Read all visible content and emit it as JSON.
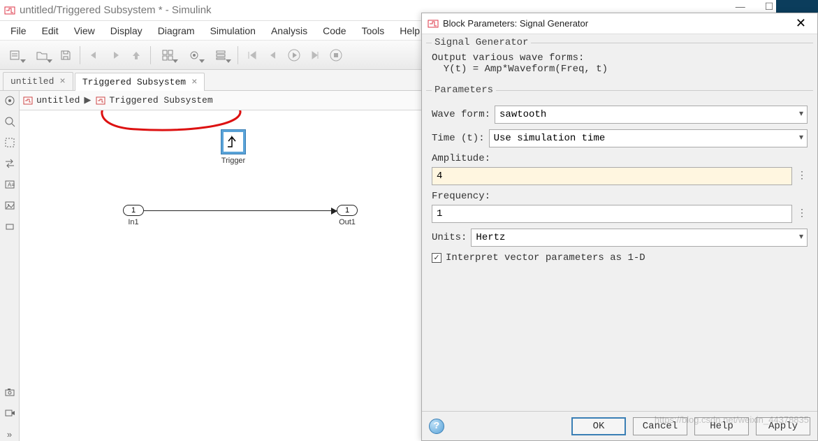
{
  "titlebar": {
    "text": "untitled/Triggered Subsystem * - Simulink"
  },
  "menu": [
    "File",
    "Edit",
    "View",
    "Display",
    "Diagram",
    "Simulation",
    "Analysis",
    "Code",
    "Tools",
    "Help"
  ],
  "tabs": {
    "items": [
      {
        "label": "untitled",
        "active": false
      },
      {
        "label": "Triggered Subsystem",
        "active": true
      }
    ]
  },
  "breadcrumb": {
    "a": "untitled",
    "b": "Triggered Subsystem"
  },
  "blocks": {
    "trigger_label": "Trigger",
    "in_port_num": "1",
    "in_label": "In1",
    "out_port_num": "1",
    "out_label": "Out1"
  },
  "dialog": {
    "title": "Block Parameters: Signal Generator",
    "section_title": "Signal Generator",
    "desc_line1": "Output various wave forms:",
    "desc_line2": "  Y(t) = Amp*Waveform(Freq, t)",
    "params_legend": "Parameters",
    "waveform_label": "Wave form:",
    "waveform_value": "sawtooth",
    "time_label": "Time (t):",
    "time_value": "Use simulation time",
    "amplitude_label": "Amplitude:",
    "amplitude_value": "4",
    "frequency_label": "Frequency:",
    "frequency_value": "1",
    "units_label": "Units:",
    "units_value": "Hertz",
    "checkbox_label": "Interpret vector parameters as 1-D",
    "ok": "OK",
    "cancel": "Cancel",
    "help": "Help",
    "apply": "Apply"
  },
  "watermark": "https://blog.csdn.net/weixin_44378835",
  "bg": {
    "min": "—",
    "max": "☐",
    "close": "✕"
  }
}
